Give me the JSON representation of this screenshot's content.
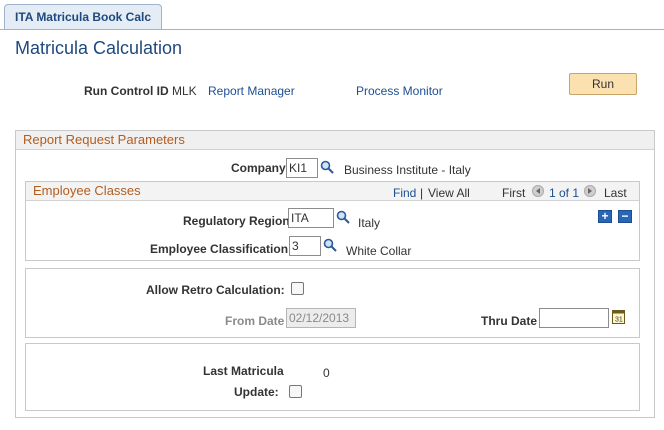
{
  "tab": {
    "label": "ITA Matricula Book Calc"
  },
  "page_title": "Matricula Calculation",
  "header": {
    "run_control_label": "Run Control ID",
    "run_control_value": "MLK",
    "report_manager_link": "Report Manager",
    "process_monitor_link": "Process Monitor",
    "run_button": "Run"
  },
  "report_params": {
    "title": "Report Request Parameters",
    "company_label": "Company",
    "company_value": "KI1",
    "company_desc": "Business Institute - Italy"
  },
  "employee_classes": {
    "title": "Employee Classes",
    "find_link": "Find",
    "separator": "|",
    "view_all_link": "View All",
    "first_label": "First",
    "pager_text": "1 of 1",
    "last_label": "Last",
    "add_button": "+",
    "delete_button": "−",
    "region_label": "Regulatory Region",
    "region_value": "ITA",
    "region_desc": "Italy",
    "classification_label": "Employee Classification",
    "classification_value": "3",
    "classification_desc": "White Collar"
  },
  "retro": {
    "allow_label": "Allow Retro Calculation:",
    "allow_checked": false,
    "from_label": "From Date",
    "from_value": "02/12/2013",
    "thru_label": "Thru Date",
    "thru_value": ""
  },
  "matricula": {
    "last_label": "Last Matricula",
    "last_value": "0",
    "update_label": "Update:",
    "update_checked": false
  },
  "colors": {
    "title_blue": "#1f497d",
    "link_blue": "#1d4f91",
    "section_orange": "#b25c1e",
    "run_button_bg": "#fbe0b0"
  }
}
